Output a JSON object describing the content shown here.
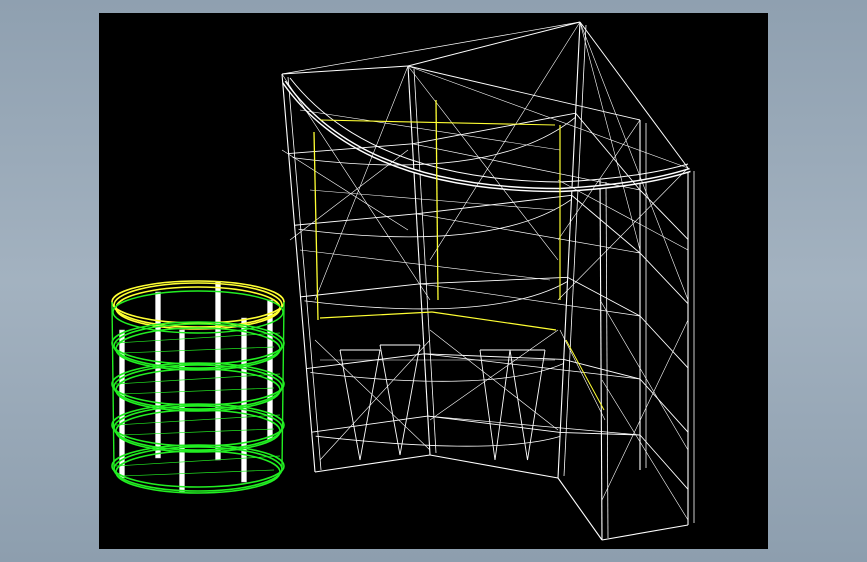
{
  "viewport": {
    "background": "#000000",
    "frame_color": "#9aaab8"
  },
  "colors": {
    "wire": "#ffffff",
    "rim": "#ffff33",
    "coil": "#22ee22"
  },
  "objects": [
    {
      "name": "corner-cabinet-wireframe",
      "color": "#ffffff",
      "shelves": 5
    },
    {
      "name": "round-rack-wireframe",
      "color": "#22ee22",
      "rings": 5,
      "posts": 6
    }
  ]
}
